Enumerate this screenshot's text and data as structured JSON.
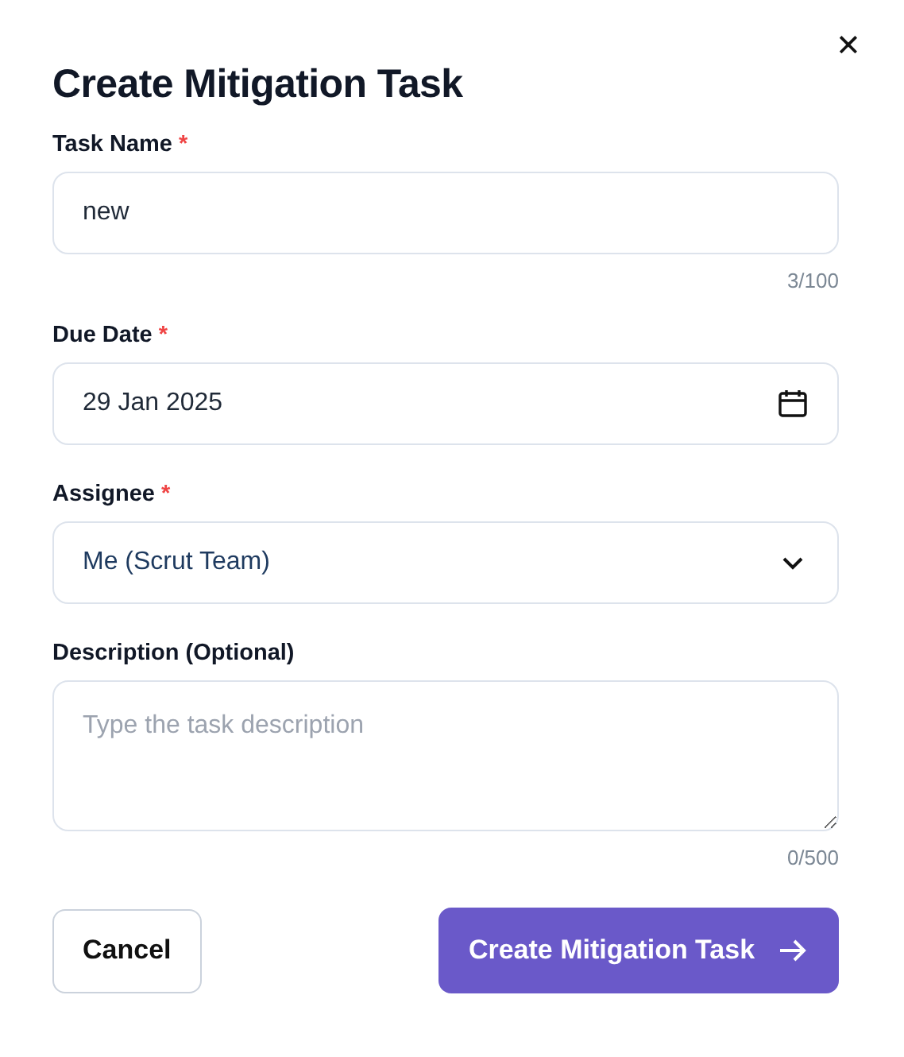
{
  "dialog": {
    "title": "Create Mitigation Task",
    "close_label": "✕"
  },
  "fields": [
    {
      "kind": "text",
      "label": "Task Name",
      "required_mark": "*",
      "value": "new",
      "counter": "3/100"
    },
    {
      "kind": "date",
      "label": "Due Date",
      "required_mark": "*",
      "value": "29 Jan 2025"
    },
    {
      "kind": "select",
      "label": "Assignee",
      "required_mark": "*",
      "value": "Me (Scrut Team)"
    },
    {
      "kind": "textarea",
      "label": "Description (Optional)",
      "placeholder": "Type the task description",
      "counter": "0/500"
    }
  ],
  "buttons": [
    {
      "kind": "secondary",
      "label": "Cancel"
    },
    {
      "kind": "primary",
      "label": "Create Mitigation Task"
    }
  ]
}
